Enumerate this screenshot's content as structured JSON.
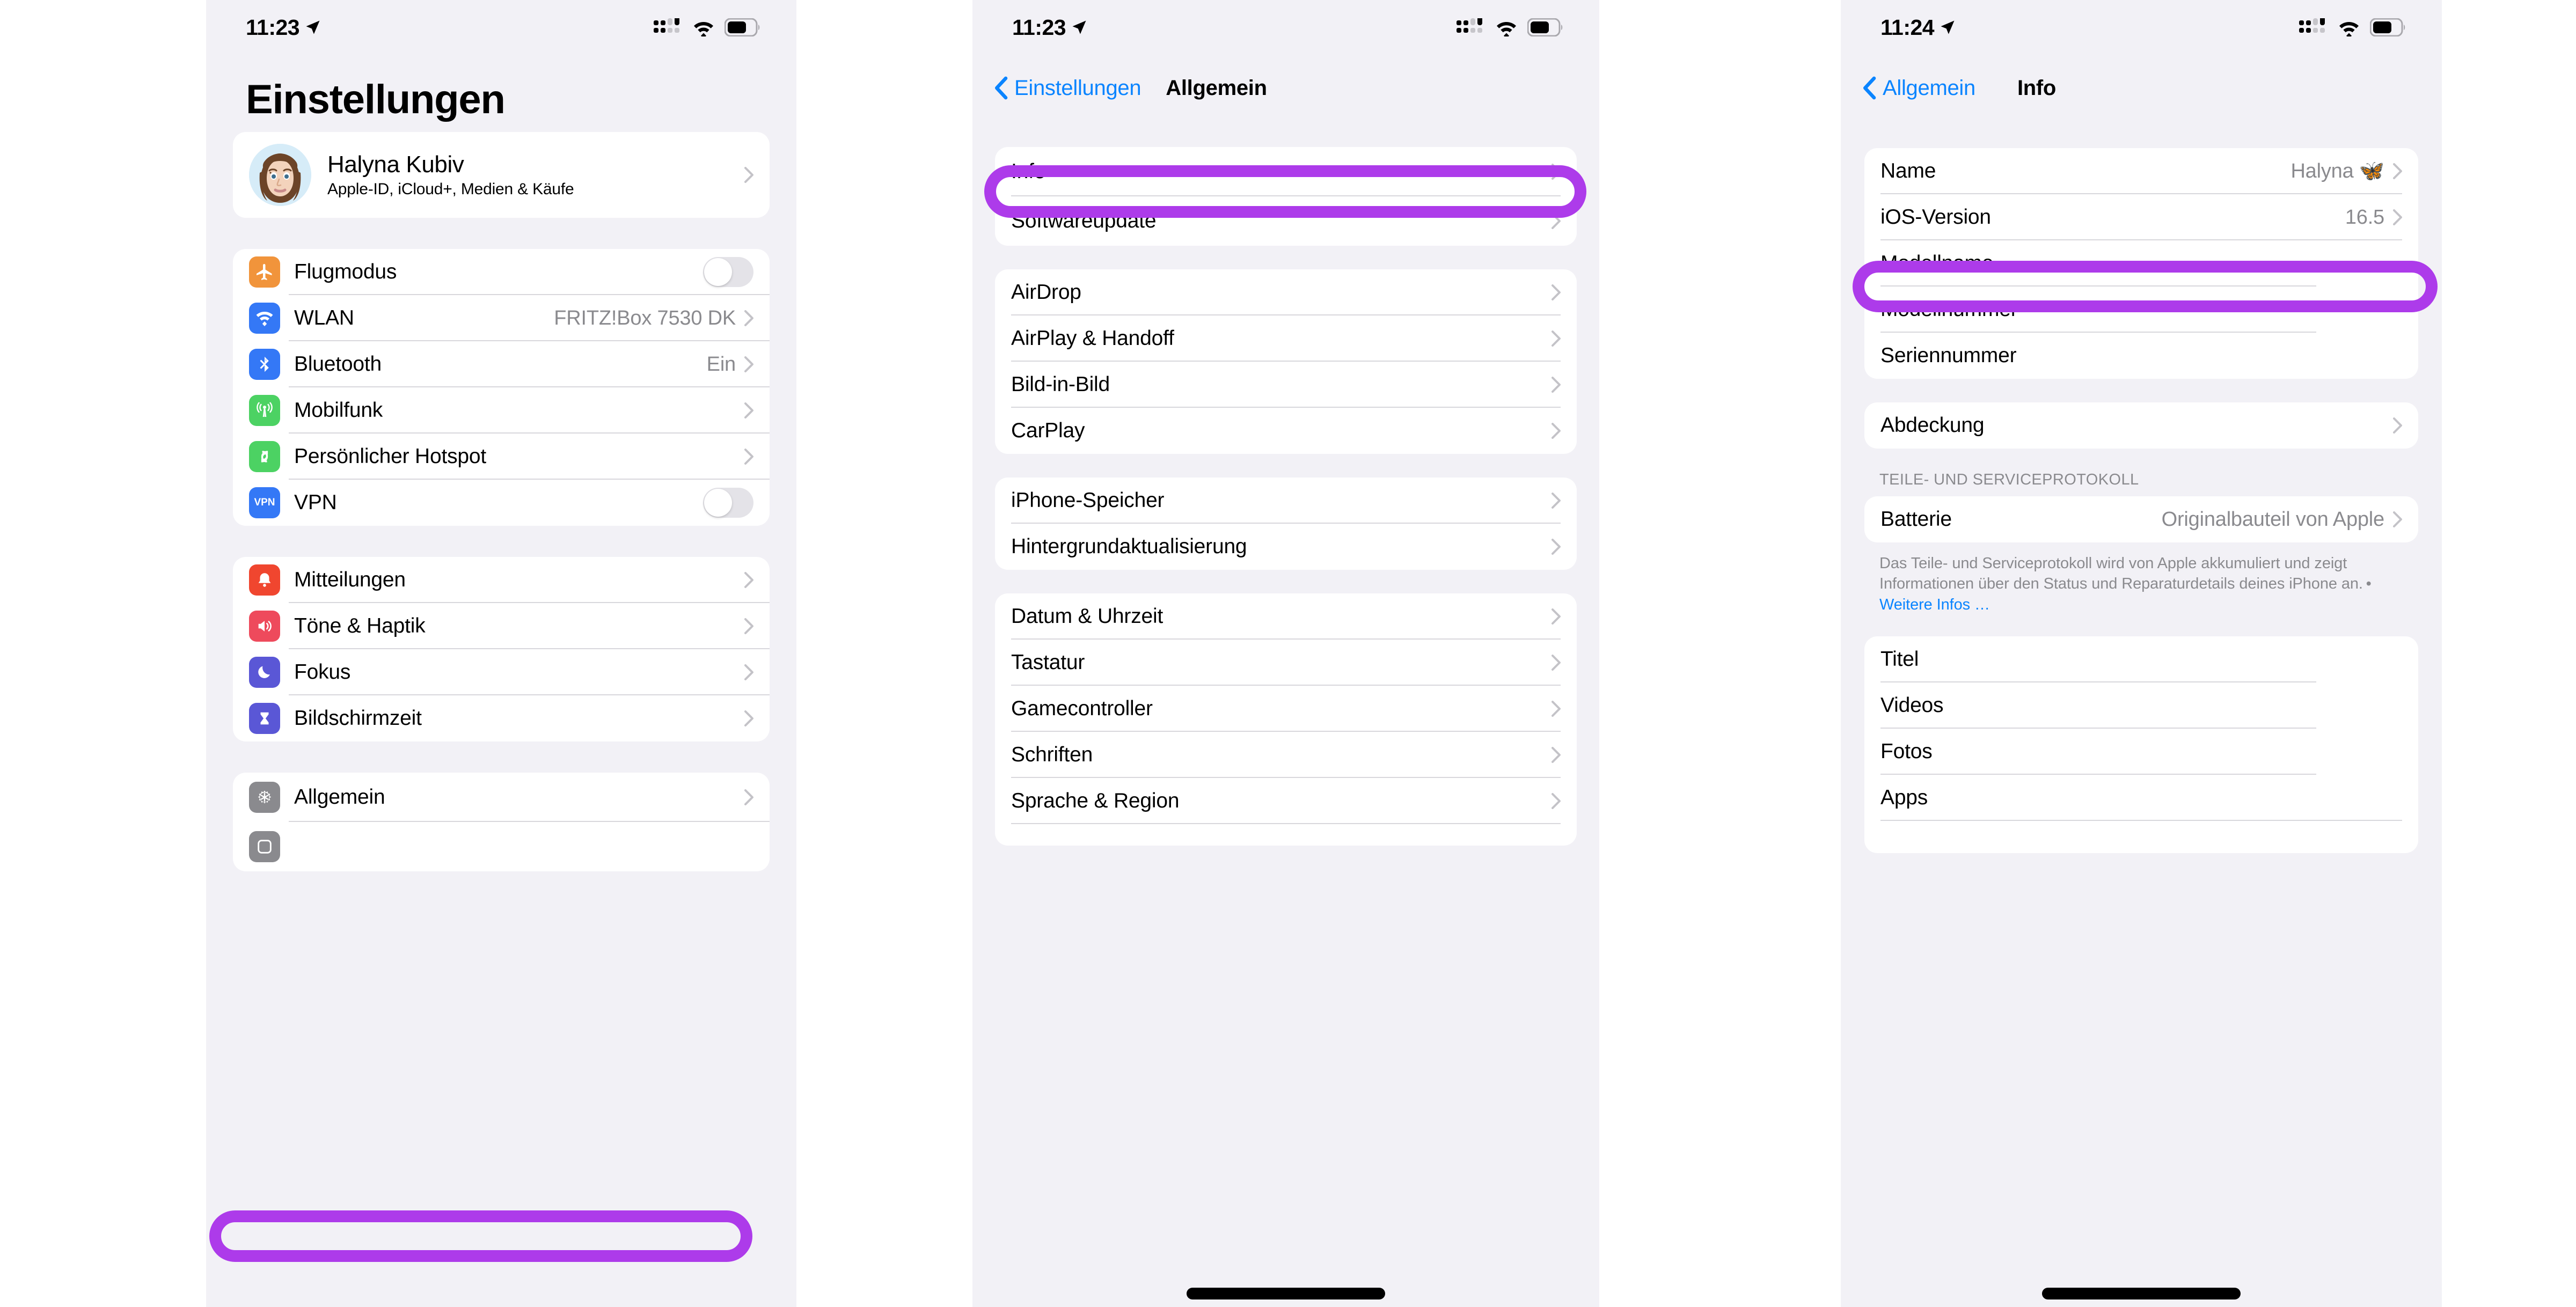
{
  "colors": {
    "highlight_purple": "#AD3BEA",
    "link_blue": "#0A84FF",
    "panel_background": "#F2F1F6",
    "card_background": "#FFFFFF",
    "secondary_text": "#8A8A8E"
  },
  "panel1": {
    "status_bar": {
      "time": "11:23",
      "location_icon": "location-arrow-icon",
      "cellular_icon": "cellular-bars-icon",
      "wifi_icon": "wifi-icon",
      "battery_icon": "battery-icon"
    },
    "title": "Einstellungen",
    "profile": {
      "name": "Halyna Kubiv",
      "subtitle": "Apple-ID, iCloud+, Medien & Käufe",
      "avatar": "memoji-avatar",
      "chevron": "chevron-right-icon"
    },
    "group1": [
      {
        "label": "Flugmodus",
        "icon": "airplane-icon",
        "icon_color": "#F1943B",
        "control": "toggle",
        "toggle_on": false
      },
      {
        "label": "WLAN",
        "icon": "wifi-icon",
        "icon_color": "#3478F6",
        "value": "FRITZ!Box 7530 DK",
        "control": "chevron"
      },
      {
        "label": "Bluetooth",
        "icon": "bluetooth-icon",
        "icon_color": "#3478F6",
        "value": "Ein",
        "control": "chevron"
      },
      {
        "label": "Mobilfunk",
        "icon": "cellular-antenna-icon",
        "icon_color": "#4CD263",
        "value": "",
        "control": "chevron"
      },
      {
        "label": "Persönlicher Hotspot",
        "icon": "hotspot-icon",
        "icon_color": "#4CD263",
        "value": "",
        "control": "chevron"
      },
      {
        "label": "VPN",
        "icon": "vpn-icon",
        "icon_color": "#3478F6",
        "control": "toggle",
        "toggle_on": false
      }
    ],
    "group2": [
      {
        "label": "Mitteilungen",
        "icon": "bell-icon",
        "icon_color": "#F0462F",
        "control": "chevron"
      },
      {
        "label": "Töne & Haptik",
        "icon": "speaker-icon",
        "icon_color": "#EE4A5C",
        "control": "chevron"
      },
      {
        "label": "Fokus",
        "icon": "moon-icon",
        "icon_color": "#5A57D6",
        "control": "chevron"
      },
      {
        "label": "Bildschirmzeit",
        "icon": "hourglass-icon",
        "icon_color": "#5A57D6",
        "control": "chevron"
      }
    ],
    "group3": [
      {
        "label": "Allgemein",
        "icon": "gear-icon",
        "icon_color": "#8A8A8E",
        "control": "chevron",
        "highlighted": true
      }
    ]
  },
  "panel2": {
    "status_bar": {
      "time": "11:23",
      "location_icon": "location-arrow-icon",
      "cellular_icon": "cellular-bars-icon",
      "wifi_icon": "wifi-icon",
      "battery_icon": "battery-icon"
    },
    "nav": {
      "back_label": "Einstellungen",
      "back_icon": "chevron-left-icon",
      "title": "Allgemein"
    },
    "group1": [
      {
        "label": "Info",
        "control": "chevron",
        "highlighted": true
      },
      {
        "label": "Softwareupdate",
        "control": "chevron"
      }
    ],
    "group2": [
      {
        "label": "AirDrop",
        "control": "chevron"
      },
      {
        "label": "AirPlay & Handoff",
        "control": "chevron"
      },
      {
        "label": "Bild-in-Bild",
        "control": "chevron"
      },
      {
        "label": "CarPlay",
        "control": "chevron"
      }
    ],
    "group3": [
      {
        "label": "iPhone-Speicher",
        "control": "chevron"
      },
      {
        "label": "Hintergrundaktualisierung",
        "control": "chevron"
      }
    ],
    "group4": [
      {
        "label": "Datum & Uhrzeit",
        "control": "chevron"
      },
      {
        "label": "Tastatur",
        "control": "chevron"
      },
      {
        "label": "Gamecontroller",
        "control": "chevron"
      },
      {
        "label": "Schriften",
        "control": "chevron"
      },
      {
        "label": "Sprache & Region",
        "control": "chevron"
      }
    ]
  },
  "panel3": {
    "status_bar": {
      "time": "11:24",
      "location_icon": "location-arrow-icon",
      "cellular_icon": "cellular-bars-icon",
      "wifi_icon": "wifi-icon",
      "battery_icon": "battery-icon"
    },
    "nav": {
      "back_label": "Allgemein",
      "back_icon": "chevron-left-icon",
      "title": "Info"
    },
    "group1": [
      {
        "label": "Name",
        "value": "Halyna 🦋",
        "control": "chevron"
      },
      {
        "label": "iOS-Version",
        "value": "16.5",
        "control": "chevron",
        "highlighted": true
      },
      {
        "label": "Modellname",
        "value": "",
        "control": "none"
      },
      {
        "label": "Modellnummer",
        "value": "",
        "control": "none"
      },
      {
        "label": "Seriennummer",
        "value": "",
        "control": "none"
      }
    ],
    "group2": [
      {
        "label": "Abdeckung",
        "value": "",
        "control": "chevron"
      }
    ],
    "service_section": {
      "header": "TEILE- UND SERVICEPROTOKOLL",
      "rows": [
        {
          "label": "Batterie",
          "value": "Originalbauteil von Apple",
          "control": "chevron"
        }
      ],
      "footer_text": "Das Teile- und Serviceprotokoll wird von Apple akkumuliert und zeigt Informationen über den Status und Reparaturdetails deines iPhone an. • ",
      "footer_link": "Weitere Infos …"
    },
    "group3": [
      {
        "label": "Titel",
        "value": "",
        "control": "none"
      },
      {
        "label": "Videos",
        "value": "",
        "control": "none"
      },
      {
        "label": "Fotos",
        "value": "",
        "control": "none"
      },
      {
        "label": "Apps",
        "value": "",
        "control": "none"
      }
    ]
  }
}
